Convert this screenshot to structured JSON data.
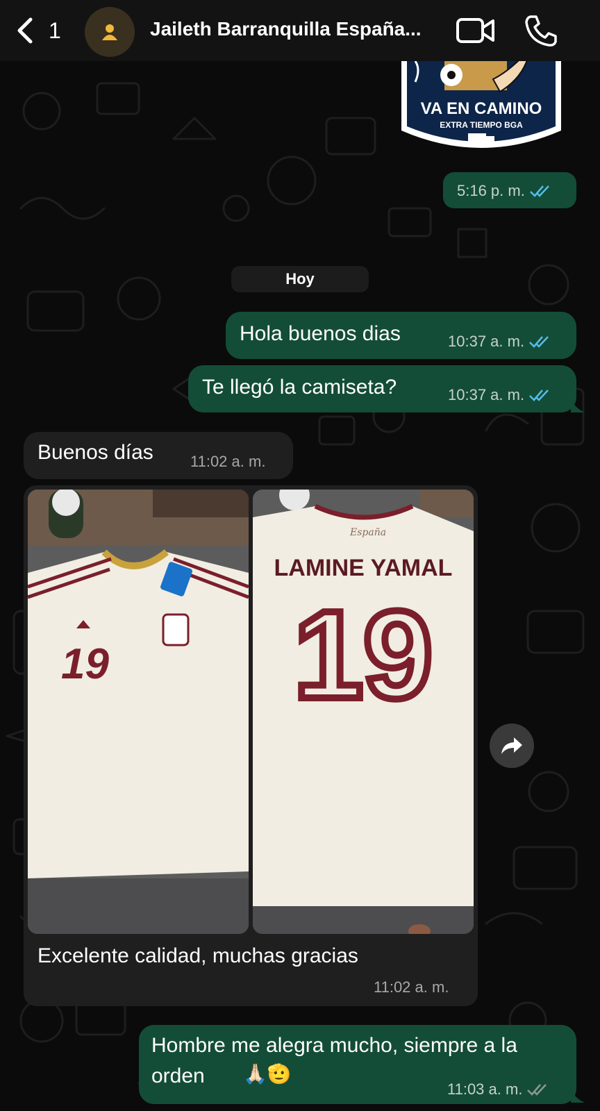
{
  "header": {
    "unread_count": "1",
    "contact_name": "Jaileth Barranquilla España..."
  },
  "sticker": {
    "line1": "VA EN CAMINO",
    "line2": "EXTRA TIEMPO BGA",
    "time": "5:16 p. m."
  },
  "day_separator": "Hoy",
  "messages": [
    {
      "direction": "outgoing",
      "text": "Hola buenos dias",
      "time": "10:37 a. m.",
      "status": "read"
    },
    {
      "direction": "outgoing",
      "text": "Te llegó la camiseta?",
      "time": "10:37 a. m.",
      "status": "read"
    },
    {
      "direction": "incoming",
      "text": "Buenos días",
      "time": "11:02 a. m."
    },
    {
      "direction": "incoming",
      "text": "Excelente calidad, muchas gracias",
      "time": "11:02 a. m.",
      "attachments": 2
    },
    {
      "direction": "outgoing",
      "text": "Hombre me alegra mucho, siempre a la orden",
      "emoji": "🙏🏻🫡",
      "time": "11:03 a. m.",
      "status": "delivered"
    }
  ],
  "photos": {
    "front": {
      "number": "19"
    },
    "back": {
      "name": "LAMINE YAMAL",
      "number": "19",
      "script": "España"
    }
  },
  "colors": {
    "outgoing_bubble": "#144d37",
    "incoming_bubble": "#1f1f1f",
    "read_ticks": "#53bdeb",
    "delivered_ticks": "#8a9a91",
    "header_bg": "#131313"
  },
  "icons": [
    "back-chevron-icon",
    "person-icon",
    "video-call-icon",
    "phone-icon",
    "forward-icon",
    "double-check-icon"
  ]
}
